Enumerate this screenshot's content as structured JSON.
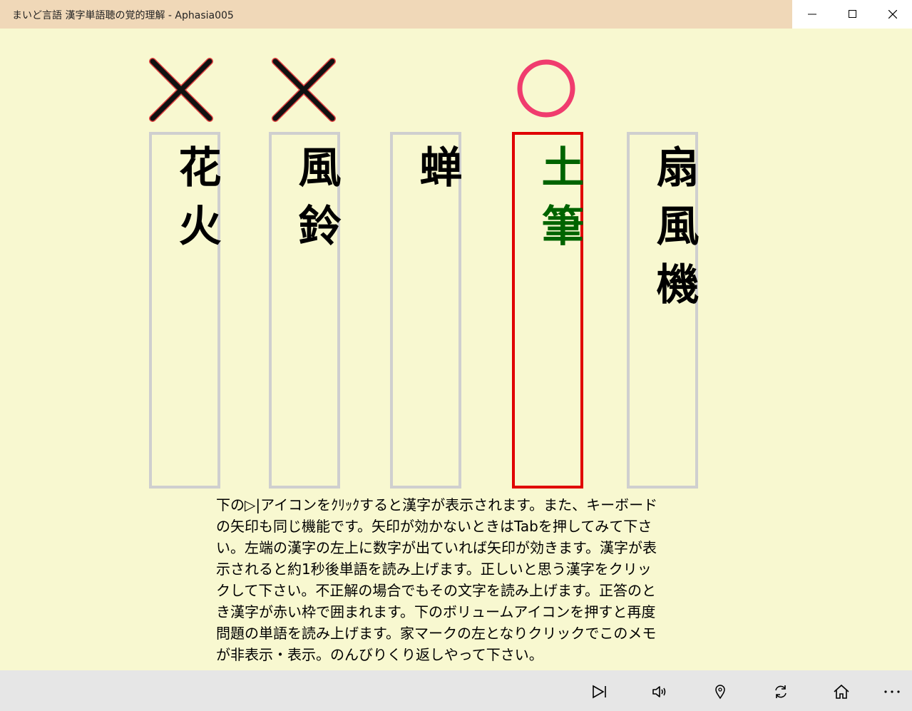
{
  "window": {
    "title": "まいど言語 漢字単語聴の覚的理解 - Aphasia005",
    "titlebar_color": "#f0d8b8",
    "background_color": "#f8f8d0"
  },
  "cards": [
    {
      "text": "花火",
      "mark": "x-mark-icon",
      "state": "incorrect"
    },
    {
      "text": "風鈴",
      "mark": "x-mark-icon",
      "state": "incorrect"
    },
    {
      "text": "蝉",
      "mark": null,
      "state": "neutral"
    },
    {
      "text": "土筆",
      "mark": "circle-mark-icon",
      "state": "correct"
    },
    {
      "text": "扇風機",
      "mark": null,
      "state": "neutral"
    }
  ],
  "colors": {
    "correct_border": "#e00000",
    "correct_text": "#006400",
    "circle_mark": "#f03c6e",
    "neutral_border": "#cfcfcf"
  },
  "instructions": "下の▷|アイコンをｸﾘｯｸすると漢字が表示されます。また、キーボードの矢印も同じ機能です。矢印が効かないときはTabを押してみて下さい。左端の漢字の左上に数字が出ていれば矢印が効きます。漢字が表示されると約1秒後単語を読み上げます。正しいと思う漢字をクリックして下さい。不正解の場合でもその文字を読み上げます。正答のとき漢字が赤い枠で囲まれます。下のボリュームアイコンを押すと再度問題の単語を読み上げます。家マークの左となりクリックでこのメモが非表示・表示。のんびりくり返しやって下さい。",
  "toolbar": {
    "buttons": [
      "next-icon",
      "volume-icon",
      "map-pin-icon",
      "refresh-icon",
      "home-icon",
      "more-icon"
    ]
  }
}
